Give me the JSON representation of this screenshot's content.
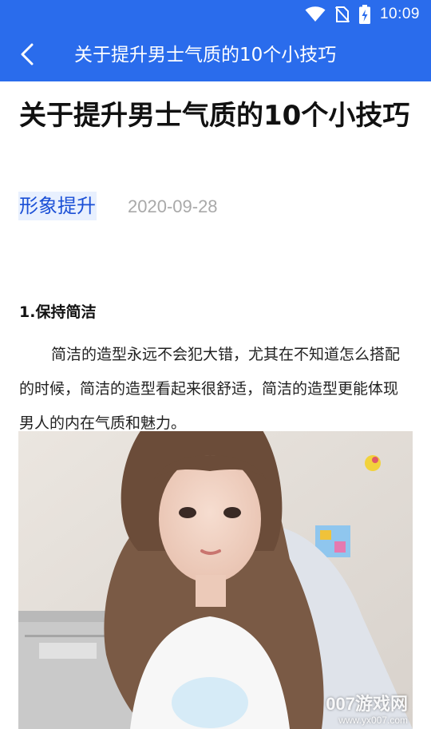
{
  "colors": {
    "app_bar": "#2a6cec",
    "tag_bg": "#e8f0fe",
    "tag_text": "#1a4fd6",
    "date_text": "#a9a9a9"
  },
  "status_bar": {
    "time": "10:09",
    "icons": [
      "wifi-icon",
      "no-sim-icon",
      "battery-charging-icon"
    ]
  },
  "toolbar": {
    "back_icon": "chevron-left-icon",
    "title": "关于提升男士气质的10个小技巧"
  },
  "article": {
    "title": "关于提升男士气质的10个小技巧",
    "category": "形象提升",
    "date": "2020-09-28",
    "section_heading": "1.保持简洁",
    "paragraph": "简洁的造型永远不会犯大错，尤其在不知道怎么搭配的时候，简洁的造型看起来很舒适，简洁的造型更能体现男人的内在气质和魅力。"
  },
  "watermark": {
    "main": "007游戏网",
    "url": "www.yx007.com"
  }
}
